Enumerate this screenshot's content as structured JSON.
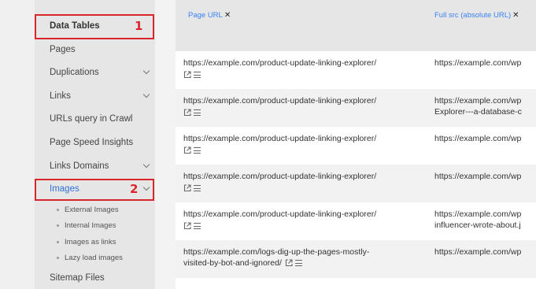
{
  "sidebar": {
    "items": [
      {
        "label": "Data Tables",
        "chevron": false
      },
      {
        "label": "Pages",
        "chevron": false
      },
      {
        "label": "Duplications",
        "chevron": true
      },
      {
        "label": "Links",
        "chevron": true
      },
      {
        "label": "URLs query in Crawl",
        "chevron": false
      },
      {
        "label": "Page Speed Insights",
        "chevron": false
      },
      {
        "label": "Links Domains",
        "chevron": true
      },
      {
        "label": "Images",
        "chevron": true
      },
      {
        "label": "Sitemap Files",
        "chevron": false
      }
    ],
    "sub_items": [
      {
        "label": "External Images"
      },
      {
        "label": "Internal Images"
      },
      {
        "label": "Images as links"
      },
      {
        "label": "Lazy load images"
      }
    ]
  },
  "annotations": {
    "badge1": "1",
    "badge2": "2",
    "color": "#d9262c"
  },
  "table": {
    "columns": [
      {
        "label": "Page URL",
        "remove": "✕"
      },
      {
        "label": "Full src (absolute URL)",
        "remove": "✕"
      }
    ],
    "rows": [
      {
        "c1": [
          "https://example.com/product-update-linking-explorer/"
        ],
        "c2": [
          "https://example.com/wp"
        ]
      },
      {
        "c1": [
          "https://example.com/product-update-linking-explorer/"
        ],
        "c2": [
          "https://example.com/wp",
          "Explorer---a-database-c"
        ]
      },
      {
        "c1": [
          "https://example.com/product-update-linking-explorer/"
        ],
        "c2": [
          "https://example.com/wp"
        ]
      },
      {
        "c1": [
          "https://example.com/product-update-linking-explorer/"
        ],
        "c2": [
          "https://example.com/wp"
        ]
      },
      {
        "c1": [
          "https://example.com/product-update-linking-explorer/"
        ],
        "c2": [
          "https://example.com/wp",
          "influencer-wrote-about.j"
        ]
      },
      {
        "c1": [
          "https://example.com/logs-dig-up-the-pages-mostly-",
          "visited-by-bot-and-ignored/"
        ],
        "c2": [
          "https://example.com/wp"
        ]
      }
    ]
  },
  "colors": {
    "accent": "#3b82f6",
    "active_nav": "#2f6fd6",
    "sidebar_bg": "#e6e6e6"
  }
}
